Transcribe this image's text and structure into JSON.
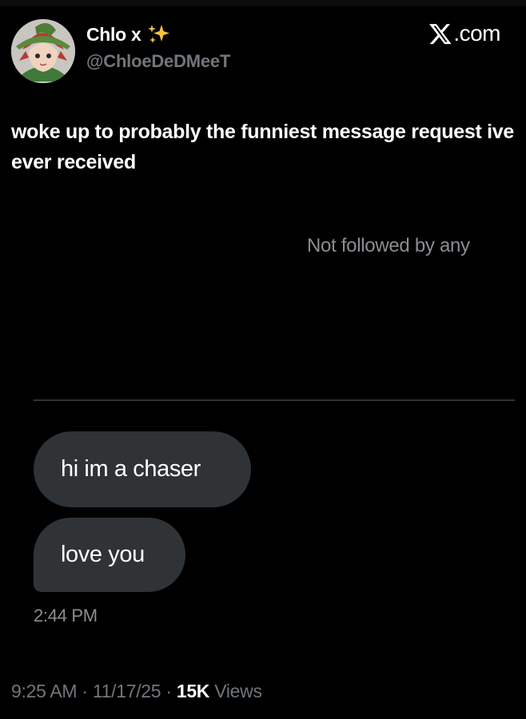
{
  "author": {
    "display_name": "Chlo x",
    "handle": "@ChloeDeDMeeT"
  },
  "brand": {
    "label": ".com"
  },
  "tweet": {
    "text": "woke up to probably the funniest message request ive ever received"
  },
  "dm": {
    "not_followed": "Not followed by any",
    "messages": [
      {
        "text": "hi im a chaser"
      },
      {
        "text": "love you"
      }
    ],
    "time": "2:44 PM"
  },
  "meta": {
    "time": "9:25 AM",
    "separator": "·",
    "date": "11/17/25",
    "views_count": "15K",
    "views_label": "Views"
  },
  "colors": {
    "background": "#000000",
    "bubble": "#2f3336",
    "muted_text": "#71767b",
    "sparkle": "#f5c542"
  },
  "icons": {
    "sparkles": "sparkles-icon",
    "brand": "x-logo-icon"
  }
}
